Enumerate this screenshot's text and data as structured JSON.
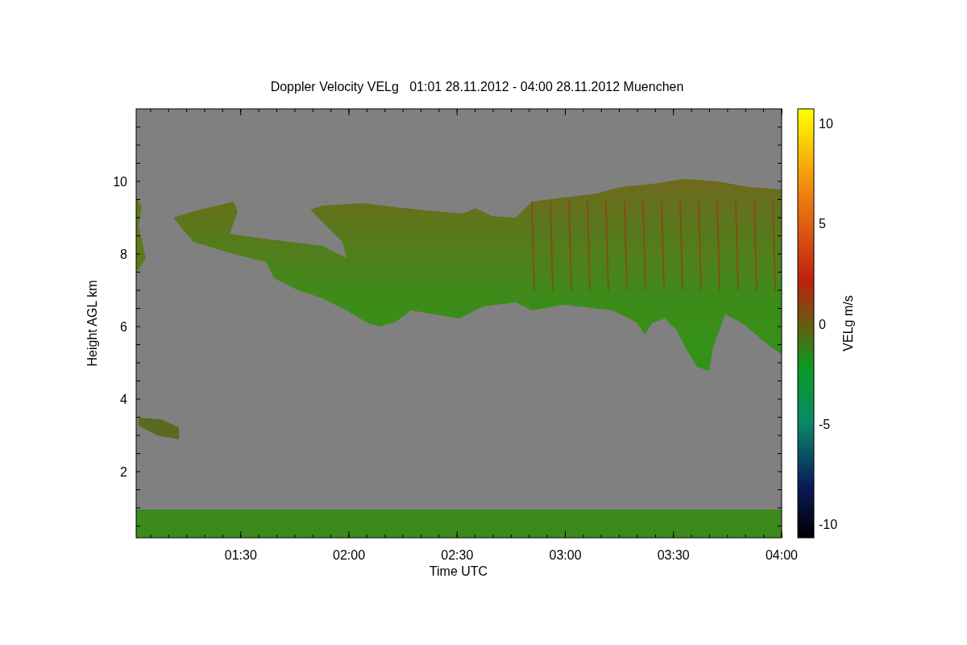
{
  "title": "Doppler Velocity VELg   01:01 28.11.2012 - 04:00 28.11.2012 Muenchen",
  "plot": {
    "xlabel": "Time UTC",
    "ylabel": "Height AGL km",
    "xticks": [
      "01:30",
      "02:00",
      "02:30",
      "03:00",
      "03:30",
      "04:00"
    ],
    "yticks": [
      "10",
      "8",
      "6",
      "4",
      "2"
    ]
  },
  "colorbar": {
    "label": "VELg m/s",
    "ticks": [
      "10",
      "5",
      "0",
      "-5",
      "-10"
    ]
  }
}
